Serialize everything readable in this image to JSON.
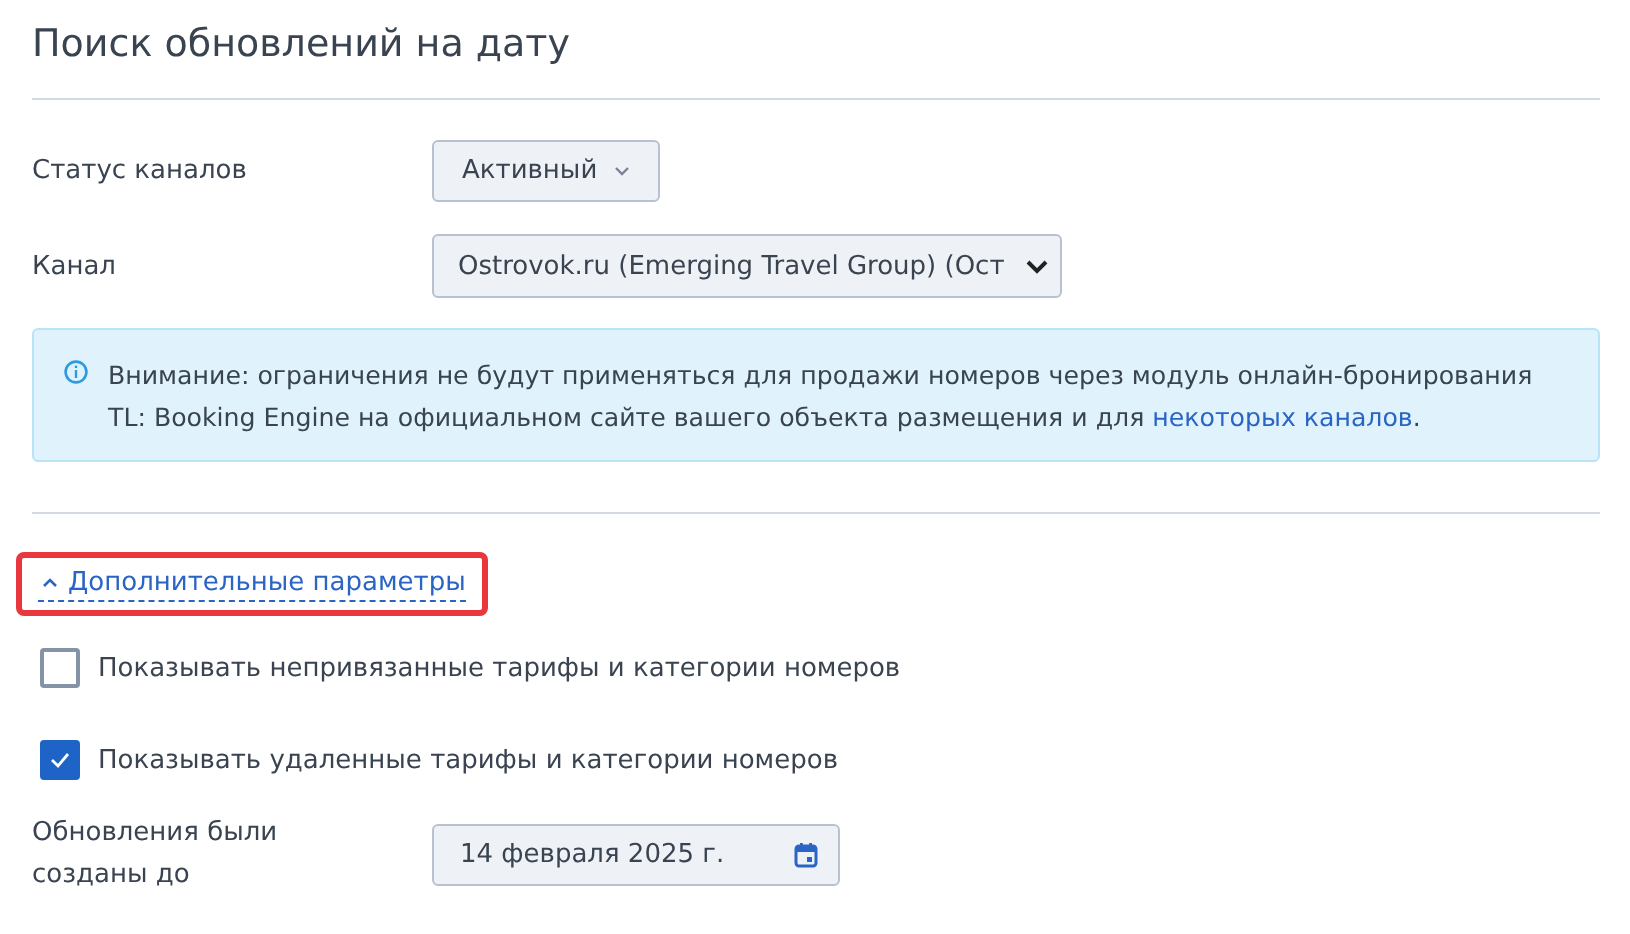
{
  "title": "Поиск обновлений на дату",
  "fields": [
    {
      "kind": "dropdown",
      "label": "Статус каналов",
      "value": "Активный"
    },
    {
      "kind": "select",
      "label": "Канал",
      "value": "Ostrovok.ru (Emerging Travel Group) (Ост"
    }
  ],
  "notice": {
    "text": "Внимание: ограничения не будут применяться для продажи номеров через модуль онлайн-бронирования TL: Booking Engine на официальном сайте вашего объекта размещения и для",
    "link": "некоторых каналов",
    "end": "."
  },
  "advanced_toggle": {
    "label": "Дополнительные параметры",
    "expanded": true,
    "highlighted": true
  },
  "checkboxes": [
    {
      "label": "Показывать непривязанные тарифы и категории номеров",
      "checked": false
    },
    {
      "label": "Показывать удаленные тарифы и категории номеров",
      "checked": true
    }
  ],
  "date_field": {
    "label": "Обновления были созданы до",
    "value": "14 февраля 2025 г."
  }
}
